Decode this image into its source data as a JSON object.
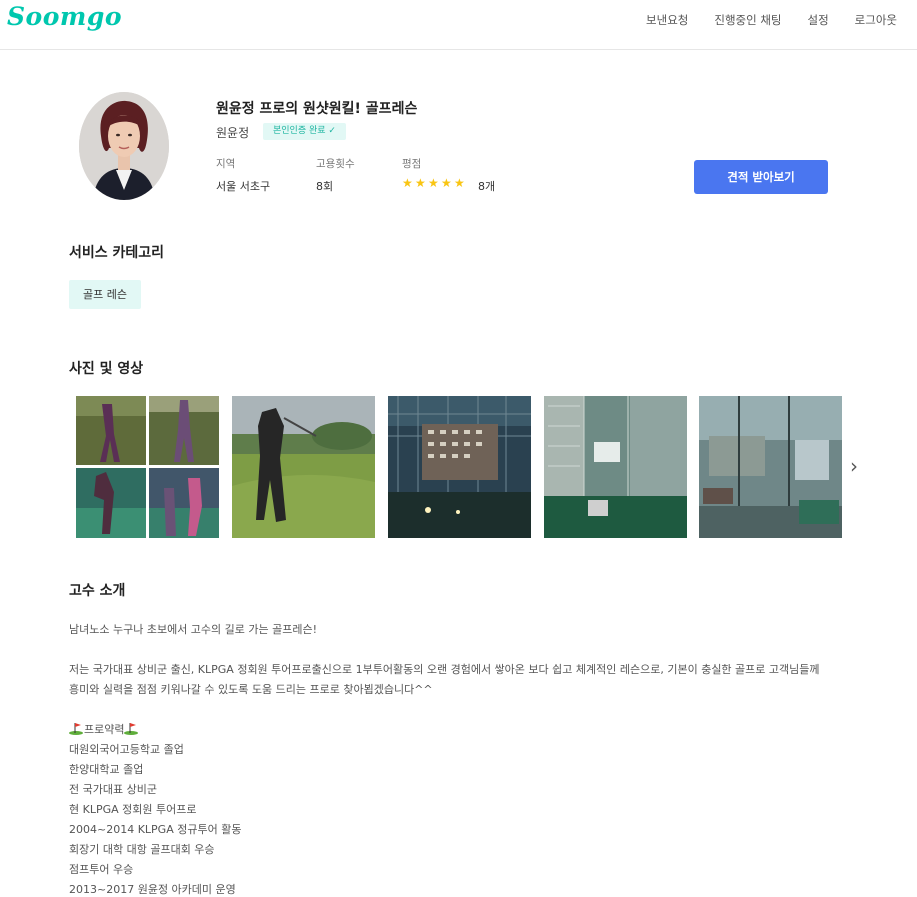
{
  "header": {
    "logo": "Soomgo",
    "nav": [
      "보낸요청",
      "진행중인 채팅",
      "설정",
      "로그아웃"
    ]
  },
  "profile": {
    "title": "원윤정 프로의 원샷원킬! 골프레슨",
    "name": "원윤정",
    "verified_badge": "본인인증 완료 ✓",
    "stats": [
      {
        "label": "지역",
        "value": "서울 서초구"
      },
      {
        "label": "고용횟수",
        "value": "8회"
      },
      {
        "label": "평점",
        "value": "8개"
      }
    ],
    "rating_stars": 5,
    "quote_button": "견적 받아보기"
  },
  "categories": {
    "title": "서비스 카테고리",
    "items": [
      "골프 레슨"
    ]
  },
  "media": {
    "title": "사진 및 영상",
    "photos": [
      "golf-collage",
      "outdoor-golf-swing",
      "driving-range-night",
      "indoor-range-green",
      "glass-building-interior"
    ]
  },
  "intro": {
    "title": "고수 소개",
    "lines": [
      "남녀노소 누구나 초보에서 고수의 길로 가는 골프레슨!",
      "",
      "저는 국가대표 상비군 출신, KLPGA 정회원 투어프로출신으로 1부투어활동의 오랜 경험에서 쌓아온 보다 쉽고 체계적인 레슨으로, 기본이 충실한 골프로 고객님들께",
      "흥미와 실력을 점점 키워나갈 수 있도록 도움 드리는 프로로 찾아뵙겠습니다^^",
      "",
      "프로약력",
      "대원외국어고등학교 졸업",
      "한양대학교 졸업",
      "전 국가대표 상비군",
      "현 KLPGA 정회원 투어프로",
      "2004~2014 KLPGA 정규투어 활동",
      "회장기 대학 대항 골프대회 우승",
      "점프투어 우승",
      "2013~2017 원윤정 아카데미 운영"
    ]
  }
}
